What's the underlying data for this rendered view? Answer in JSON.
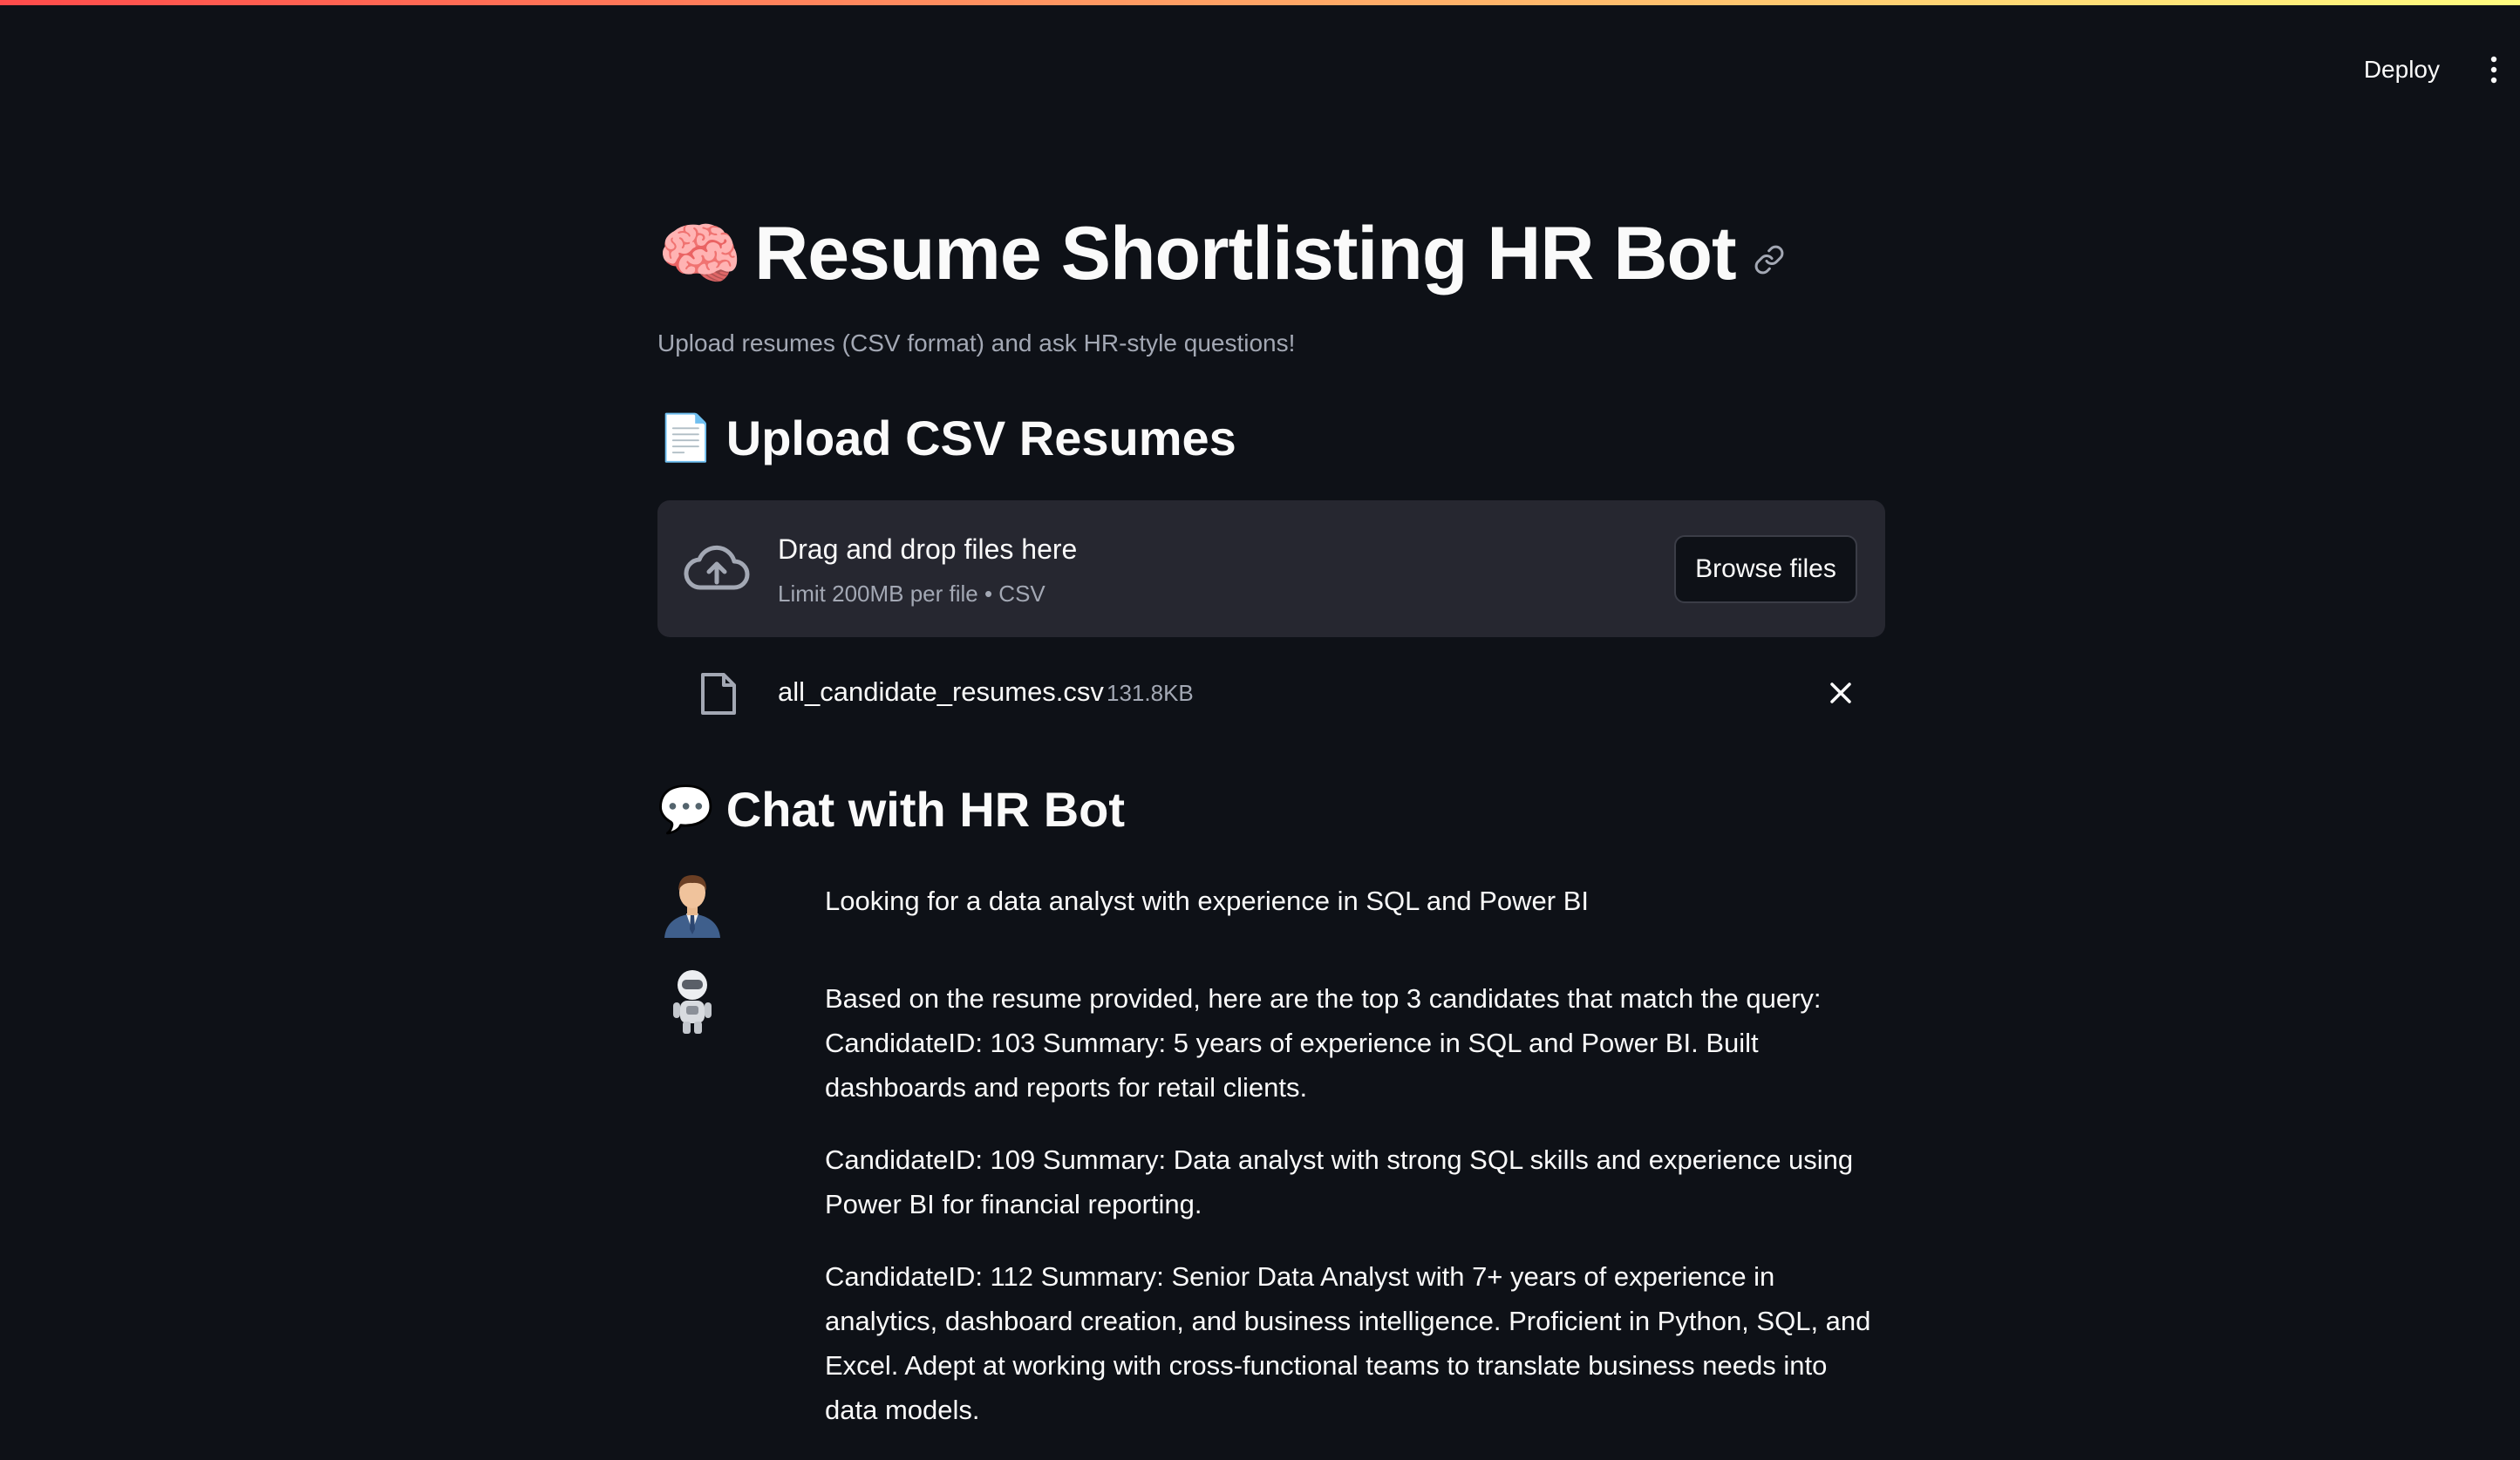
{
  "header": {
    "deploy_label": "Deploy"
  },
  "page": {
    "title_emoji": "🧠",
    "title": "Resume Shortlisting HR Bot",
    "subtitle": "Upload resumes (CSV format) and ask HR-style questions!"
  },
  "upload_section": {
    "emoji": "📄",
    "heading": "Upload CSV Resumes",
    "drop_label": "Drag and drop files here",
    "limit_text": "Limit 200MB per file • CSV",
    "browse_label": "Browse files",
    "file": {
      "name": "all_candidate_resumes.csv",
      "size": "131.8KB"
    }
  },
  "chat_section": {
    "emoji": "💬",
    "heading": "Chat with HR Bot",
    "messages": [
      {
        "role": "user",
        "text": "Looking for a data analyst with experience in SQL and Power BI"
      },
      {
        "role": "assistant",
        "paragraphs": [
          "Based on the resume provided, here are the top 3 candidates that match the query: CandidateID: 103 Summary: 5 years of experience in SQL and Power BI. Built dashboards and reports for retail clients.",
          "CandidateID: 109 Summary: Data analyst with strong SQL skills and experience using Power BI for financial reporting.",
          "CandidateID: 112 Summary: Senior Data Analyst with 7+ years of experience in analytics, dashboard creation, and business intelligence. Proficient in Python, SQL, and Excel. Adept at working with cross-functional teams to translate business needs into data models."
        ]
      }
    ]
  },
  "colors": {
    "background": "#0e1117",
    "surface": "#262730",
    "text": "#fafafa",
    "muted": "#a3a8b4",
    "accent_start": "#ff4b4b",
    "accent_end": "#fffd80"
  },
  "icons": {
    "menu": "vertical-dots-icon",
    "link": "link-icon",
    "upload": "cloud-upload-icon",
    "file": "file-icon",
    "remove": "close-icon",
    "user_avatar": "businessman-avatar-icon",
    "bot_avatar": "robot-avatar-icon"
  }
}
